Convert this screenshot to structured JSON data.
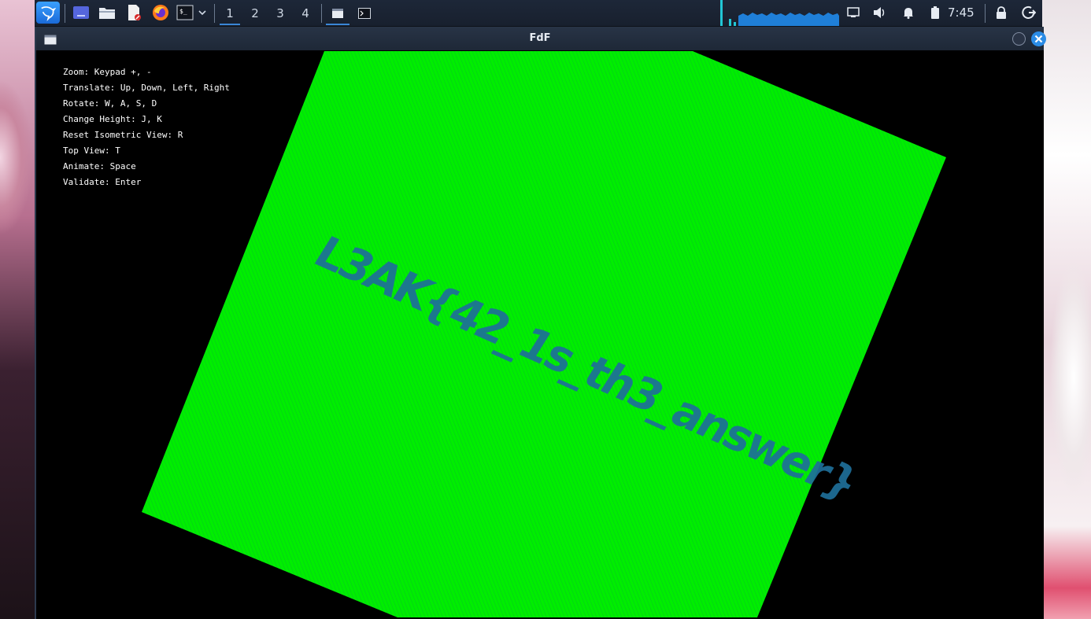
{
  "taskbar": {
    "workspaces": [
      "1",
      "2",
      "3",
      "4"
    ],
    "active_workspace": "1",
    "clock": "7:45",
    "icons": [
      "kali-menu-icon",
      "desktop-icon",
      "file-manager-icon",
      "text-editor-icon",
      "firefox-icon",
      "terminal-icon",
      "chevron-down-icon",
      "window-task-icon",
      "terminal-task-icon",
      "network-icon",
      "volume-icon",
      "notification-bell-icon",
      "battery-icon",
      "lock-icon",
      "logout-icon"
    ],
    "accent": "#3a86d6"
  },
  "window": {
    "title": "FdF"
  },
  "help": {
    "lines": [
      "Zoom: Keypad +, -",
      "Translate: Up, Down, Left, Right",
      "Rotate: W, A, S, D",
      "Change Height: J, K",
      "Reset Isometric View: R",
      "Top View: T",
      "Animate: Space",
      "Validate: Enter"
    ]
  },
  "render": {
    "mesh_color": "#00ee00",
    "text_color": "#1f6f9a",
    "embedded_text": "L3AK{42_1s_th3_answer}"
  }
}
